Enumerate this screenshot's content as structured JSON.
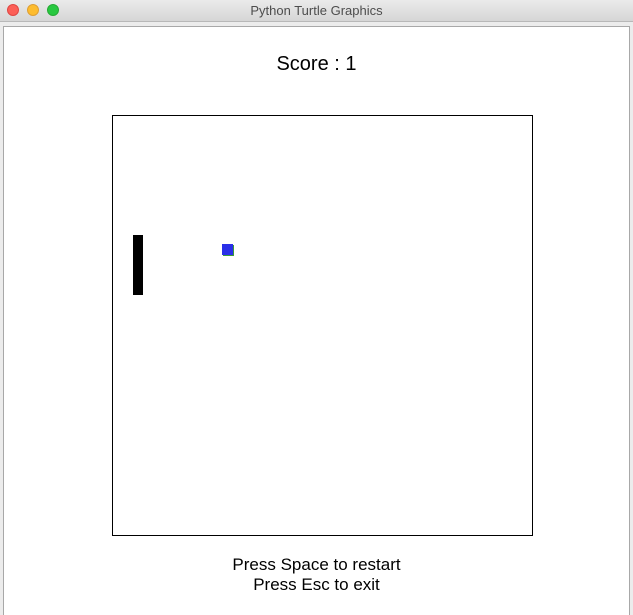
{
  "window": {
    "title": "Python Turtle Graphics"
  },
  "game": {
    "score_text": "Score : 1",
    "instructions": {
      "restart": "Press Space to restart",
      "exit": "Press Esc to exit"
    },
    "colors": {
      "ball": "#2a2fe8",
      "paddle": "#000000",
      "border": "#000000",
      "background": "#ffffff"
    }
  }
}
